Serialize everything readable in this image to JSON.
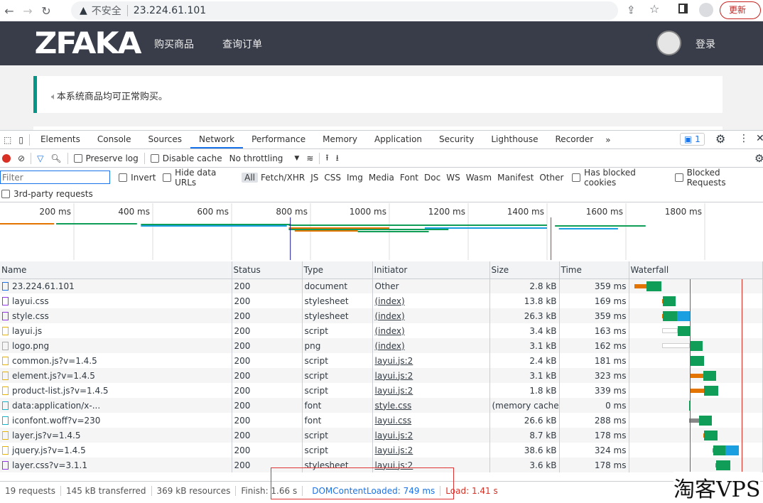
{
  "browser": {
    "insecure_label": "不安全",
    "url": "23.224.61.101",
    "update_label": "更新"
  },
  "site": {
    "logo": "ZFAKA",
    "nav": [
      "购买商品",
      "查询订单"
    ],
    "login": "登录",
    "notice": "本系统商品均可正常购买。"
  },
  "devtools": {
    "tabs": [
      "Elements",
      "Console",
      "Sources",
      "Network",
      "Performance",
      "Memory",
      "Application",
      "Security",
      "Lighthouse",
      "Recorder"
    ],
    "active_tab": "Network",
    "issues_count": "1",
    "toolbar": {
      "preserve_log": "Preserve log",
      "disable_cache": "Disable cache",
      "throttling": "No throttling"
    },
    "filter": {
      "placeholder": "Filter",
      "invert": "Invert",
      "hide_data_urls": "Hide data URLs",
      "types": [
        "All",
        "Fetch/XHR",
        "JS",
        "CSS",
        "Img",
        "Media",
        "Font",
        "Doc",
        "WS",
        "Wasm",
        "Manifest",
        "Other"
      ],
      "has_blocked_cookies": "Has blocked cookies",
      "blocked_requests": "Blocked Requests",
      "third_party": "3rd-party requests"
    },
    "overview_ticks": [
      "200 ms",
      "400 ms",
      "600 ms",
      "800 ms",
      "1000 ms",
      "1200 ms",
      "1400 ms",
      "1600 ms",
      "1800 ms",
      "200"
    ],
    "columns": [
      "Name",
      "Status",
      "Type",
      "Initiator",
      "Size",
      "Time",
      "Waterfall"
    ],
    "rows": [
      {
        "name": "23.224.61.101",
        "status": "200",
        "type": "document",
        "initiator": "Other",
        "size": "2.8 kB",
        "time": "359 ms",
        "icon": "document-icon",
        "color": "#1a73e8",
        "wf": [
          50,
          150,
          190
        ]
      },
      {
        "name": "layui.css",
        "status": "200",
        "type": "stylesheet",
        "initiator": "(index)",
        "size": "13.8 kB",
        "time": "169 ms",
        "icon": "stylesheet-icon",
        "color": "#9334e6",
        "wf": [
          400,
          10,
          160
        ]
      },
      {
        "name": "style.css",
        "status": "200",
        "type": "stylesheet",
        "initiator": "(index)",
        "size": "26.3 kB",
        "time": "359 ms",
        "icon": "stylesheet-icon",
        "color": "#9334e6",
        "wf": [
          400,
          10,
          180,
          170
        ]
      },
      {
        "name": "layui.js",
        "status": "200",
        "type": "script",
        "initiator": "(index)",
        "size": "3.4 kB",
        "time": "163 ms",
        "icon": "script-icon",
        "color": "#e8b400",
        "wf": [
          400,
          200,
          160
        ],
        "queue": true
      },
      {
        "name": "logo.png",
        "status": "200",
        "type": "png",
        "initiator": "(index)",
        "size": "3.1 kB",
        "time": "162 ms",
        "icon": "image-icon",
        "color": "#aaa",
        "wf": [
          400,
          350,
          160
        ],
        "queue": true
      },
      {
        "name": "common.js?v=1.4.5",
        "status": "200",
        "type": "script",
        "initiator": "layui.js:2",
        "size": "2.4 kB",
        "time": "181 ms",
        "icon": "script-icon",
        "color": "#e8b400",
        "wf": [
          750,
          10,
          170
        ]
      },
      {
        "name": "element.js?v=1.4.5",
        "status": "200",
        "type": "script",
        "initiator": "layui.js:2",
        "size": "3.1 kB",
        "time": "323 ms",
        "icon": "script-icon",
        "color": "#e8b400",
        "wf": [
          760,
          160,
          170
        ]
      },
      {
        "name": "product-list.js?v=1.4.5",
        "status": "200",
        "type": "script",
        "initiator": "layui.js:2",
        "size": "1.8 kB",
        "time": "339 ms",
        "icon": "script-icon",
        "color": "#e8b400",
        "wf": [
          760,
          170,
          180
        ]
      },
      {
        "name": "data:application/x-...",
        "status": "200",
        "type": "font",
        "initiator": "style.css",
        "size": "(memory cache)",
        "time": "0 ms",
        "icon": "font-icon",
        "color": "#12b5cb",
        "wf": [
          740,
          0,
          15
        ]
      },
      {
        "name": "iconfont.woff?v=230",
        "status": "200",
        "type": "font",
        "initiator": "layui.css",
        "size": "26.6 kB",
        "time": "288 ms",
        "icon": "font-icon",
        "color": "#12b5cb",
        "wf": [
          745,
          120,
          170
        ],
        "grey": true
      },
      {
        "name": "layer.js?v=1.4.5",
        "status": "200",
        "type": "script",
        "initiator": "layui.js:2",
        "size": "8.7 kB",
        "time": "178 ms",
        "icon": "script-icon",
        "color": "#e8b400",
        "wf": [
          920,
          10,
          170
        ]
      },
      {
        "name": "jquery.js?v=1.4.5",
        "status": "200",
        "type": "script",
        "initiator": "layui.js:2",
        "size": "38.6 kB",
        "time": "324 ms",
        "icon": "script-icon",
        "color": "#e8b400",
        "wf": [
          1040,
          10,
          150,
          170
        ]
      },
      {
        "name": "layer.css?v=3.1.1",
        "status": "200",
        "type": "stylesheet",
        "initiator": "layui.js:2",
        "size": "3.6 kB",
        "time": "178 ms",
        "icon": "stylesheet-icon",
        "color": "#9334e6",
        "wf": [
          1080,
          10,
          175
        ]
      }
    ],
    "status_bar": {
      "requests": "19 requests",
      "transferred": "145 kB transferred",
      "resources": "369 kB resources",
      "finish": "Finish: 1.66 s",
      "dom_content_loaded": "DOMContentLoaded: 749 ms",
      "load": "Load: 1.41 s"
    },
    "timing_ms": {
      "dom_content_loaded": 749,
      "load": 1410
    },
    "colors": {
      "dcl": "#1a73e8",
      "load": "#d93025",
      "waiting": "#0f9d58",
      "download": "#1a9fe0",
      "queue": "#e37400"
    }
  },
  "watermark": "淘客VPS"
}
